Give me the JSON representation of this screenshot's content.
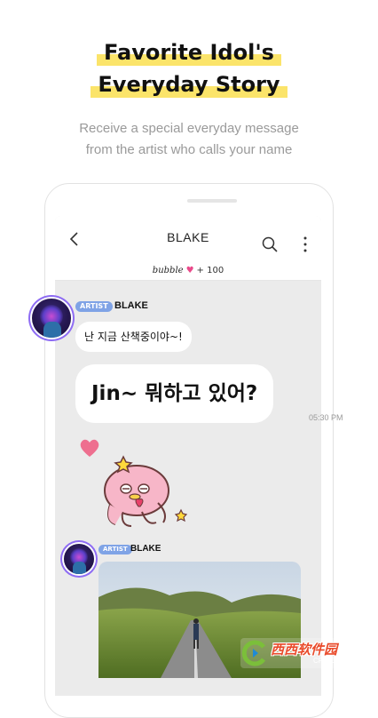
{
  "headline": {
    "line1": "Favorite Idol's",
    "line2": "Everyday Story",
    "highlight_color": "#fbe46a"
  },
  "subtitle": {
    "line1": "Receive a special everyday message",
    "line2": "from the artist who calls your name"
  },
  "chat": {
    "title": "BLAKE",
    "icons": {
      "back": "chevron-left-icon",
      "search": "search-icon",
      "more": "more-vertical-icon"
    },
    "bubble_bar": {
      "logo": "bubble",
      "count": "+ 100",
      "heart_color": "#e94a8a"
    },
    "messages": [
      {
        "badge": "ARTIST",
        "sender": "BLAKE",
        "texts": [
          "난 지금 산책중이야~!",
          "Jin~ 뭐하고 있어?"
        ],
        "time": "05:30 PM"
      },
      {
        "badge": "ARTIST",
        "sender": "BLAKE",
        "photo": "landscape-road-photo"
      }
    ],
    "badge_color": "#7fa3e6"
  },
  "watermark": {
    "text": "西西软件园",
    "sub": "CR173.COM"
  }
}
